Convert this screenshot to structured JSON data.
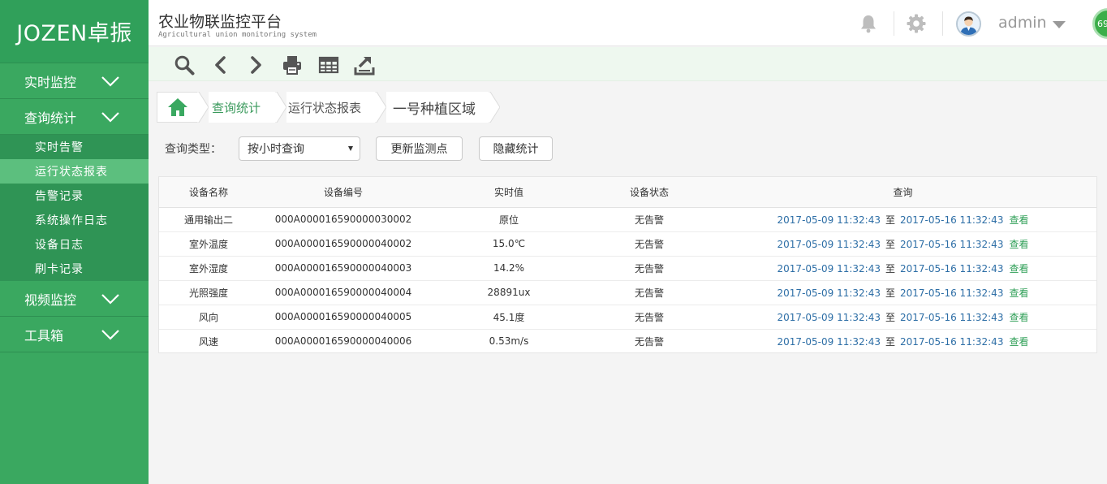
{
  "brand": {
    "logo_text": "JOZEN卓振"
  },
  "header": {
    "title": "农业物联监控平台",
    "subtitle": "Agricultural union monitoring system",
    "user_name": "admin",
    "badge_text": "69"
  },
  "sidebar": {
    "groups": [
      {
        "label": "实时监控"
      },
      {
        "label": "查询统计"
      },
      {
        "label": "视频监控"
      },
      {
        "label": "工具箱"
      }
    ],
    "sub_items": [
      {
        "label": "实时告警"
      },
      {
        "label": "运行状态报表"
      },
      {
        "label": "告警记录"
      },
      {
        "label": "系统操作日志"
      },
      {
        "label": "设备日志"
      },
      {
        "label": "刷卡记录"
      }
    ],
    "active_sub_item": "运行状态报表"
  },
  "toolbar": {
    "icons": [
      "search-icon",
      "back-icon",
      "forward-icon",
      "print-icon",
      "table-icon",
      "export-icon"
    ]
  },
  "breadcrumb": {
    "items": [
      {
        "label": "查询统计"
      },
      {
        "label": "运行状态报表"
      },
      {
        "label": "一号种植区域"
      }
    ]
  },
  "filter": {
    "label": "查询类型：",
    "selected": "按小时查询",
    "buttons": [
      {
        "label": "更新监测点"
      },
      {
        "label": "隐藏统计"
      }
    ]
  },
  "table": {
    "headers": [
      "设备名称",
      "设备编号",
      "实时值",
      "设备状态",
      "查询"
    ],
    "range_separator": "至",
    "view_label": "查看",
    "rows": [
      {
        "name": "通用输出二",
        "code": "000A000016590000030002",
        "value": "原位",
        "status": "无告警",
        "start": "2017-05-09 11:32:43",
        "end": "2017-05-16 11:32:43"
      },
      {
        "name": "室外温度",
        "code": "000A000016590000040002",
        "value": "15.0℃",
        "status": "无告警",
        "start": "2017-05-09 11:32:43",
        "end": "2017-05-16 11:32:43"
      },
      {
        "name": "室外湿度",
        "code": "000A000016590000040003",
        "value": "14.2%",
        "status": "无告警",
        "start": "2017-05-09 11:32:43",
        "end": "2017-05-16 11:32:43"
      },
      {
        "name": "光照强度",
        "code": "000A000016590000040004",
        "value": "28891ux",
        "status": "无告警",
        "start": "2017-05-09 11:32:43",
        "end": "2017-05-16 11:32:43"
      },
      {
        "name": "风向",
        "code": "000A000016590000040005",
        "value": "45.1度",
        "status": "无告警",
        "start": "2017-05-09 11:32:43",
        "end": "2017-05-16 11:32:43"
      },
      {
        "name": "风速",
        "code": "000A000016590000040006",
        "value": "0.53m/s",
        "status": "无告警",
        "start": "2017-05-09 11:32:43",
        "end": "2017-05-16 11:32:43"
      }
    ]
  },
  "colors": {
    "sidebar_bg": "#3aa860",
    "sidebar_active": "#5cbf7e",
    "link_blue": "#2d6ea6",
    "link_green": "#2f9f57"
  }
}
